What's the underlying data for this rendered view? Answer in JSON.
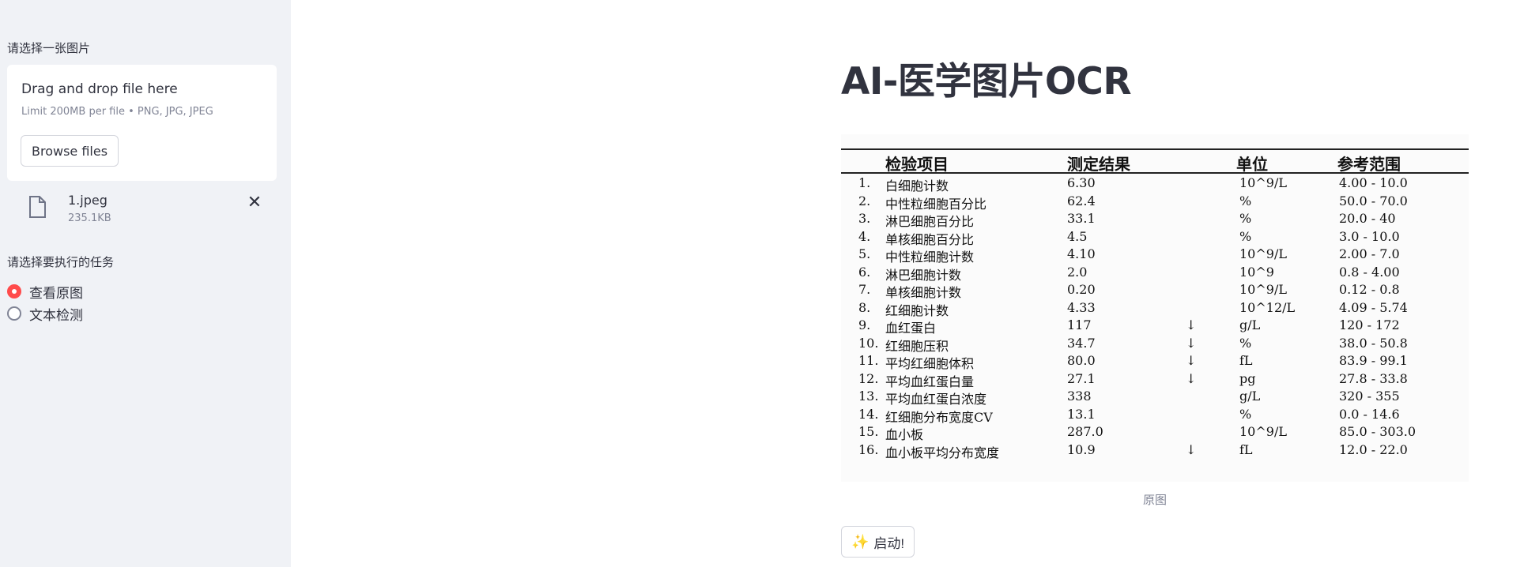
{
  "sidebar": {
    "upload_label": "请选择一张图片",
    "dropzone": {
      "title": "Drag and drop file here",
      "limit": "Limit 200MB per file • PNG, JPG, JPEG",
      "browse_label": "Browse files"
    },
    "file": {
      "name": "1.jpeg",
      "size": "235.1KB",
      "icon": "file-icon",
      "close_icon": "close-icon"
    },
    "task_label": "请选择要执行的任务",
    "task_options": [
      {
        "label": "查看原图",
        "checked": true
      },
      {
        "label": "文本检测",
        "checked": false
      }
    ]
  },
  "main": {
    "title": "AI-医学图片OCR",
    "caption": "原图",
    "start_button": "启动!",
    "start_icon": "sparkle-icon"
  },
  "document": {
    "headers": [
      "检验项目",
      "测定结果",
      "单位",
      "参考范围"
    ],
    "rows": [
      {
        "no": "1.",
        "item": "白细胞计数",
        "result": "6.30",
        "flag": "",
        "unit": "10^9/L",
        "range": "4.00 - 10.0"
      },
      {
        "no": "2.",
        "item": "中性粒细胞百分比",
        "result": "62.4",
        "flag": "",
        "unit": "%",
        "range": "50.0 - 70.0"
      },
      {
        "no": "3.",
        "item": "淋巴细胞百分比",
        "result": "33.1",
        "flag": "",
        "unit": "%",
        "range": "20.0 - 40"
      },
      {
        "no": "4.",
        "item": "单核细胞百分比",
        "result": "4.5",
        "flag": "",
        "unit": "%",
        "range": "3.0 - 10.0"
      },
      {
        "no": "5.",
        "item": "中性粒细胞计数",
        "result": "4.10",
        "flag": "",
        "unit": "10^9/L",
        "range": "2.00 - 7.0"
      },
      {
        "no": "6.",
        "item": "淋巴细胞计数",
        "result": "2.0",
        "flag": "",
        "unit": "10^9",
        "range": "0.8 - 4.00"
      },
      {
        "no": "7.",
        "item": "单核细胞计数",
        "result": "0.20",
        "flag": "",
        "unit": "10^9/L",
        "range": "0.12 - 0.8"
      },
      {
        "no": "8.",
        "item": "红细胞计数",
        "result": "4.33",
        "flag": "",
        "unit": "10^12/L",
        "range": "4.09 - 5.74"
      },
      {
        "no": "9.",
        "item": "血红蛋白",
        "result": "117",
        "flag": "↓",
        "unit": "g/L",
        "range": "120 - 172"
      },
      {
        "no": "10.",
        "item": "红细胞压积",
        "result": "34.7",
        "flag": "↓",
        "unit": "%",
        "range": "38.0 - 50.8"
      },
      {
        "no": "11.",
        "item": "平均红细胞体积",
        "result": "80.0",
        "flag": "↓",
        "unit": "fL",
        "range": "83.9 - 99.1"
      },
      {
        "no": "12.",
        "item": "平均血红蛋白量",
        "result": "27.1",
        "flag": "↓",
        "unit": "pg",
        "range": "27.8 - 33.8"
      },
      {
        "no": "13.",
        "item": "平均血红蛋白浓度",
        "result": "338",
        "flag": "",
        "unit": "g/L",
        "range": "320 - 355"
      },
      {
        "no": "14.",
        "item": "红细胞分布宽度CV",
        "result": "13.1",
        "flag": "",
        "unit": "%",
        "range": "0.0 - 14.6"
      },
      {
        "no": "15.",
        "item": "血小板",
        "result": "287.0",
        "flag": "",
        "unit": "10^9/L",
        "range": "85.0 - 303.0"
      },
      {
        "no": "16.",
        "item": "血小板平均分布宽度",
        "result": "10.9",
        "flag": "↓",
        "unit": "fL",
        "range": "12.0 - 22.0"
      }
    ]
  },
  "colors": {
    "sidebar_bg": "#f0f2f6",
    "accent": "#ff4b4b",
    "text": "#31333f",
    "muted": "#808495"
  }
}
